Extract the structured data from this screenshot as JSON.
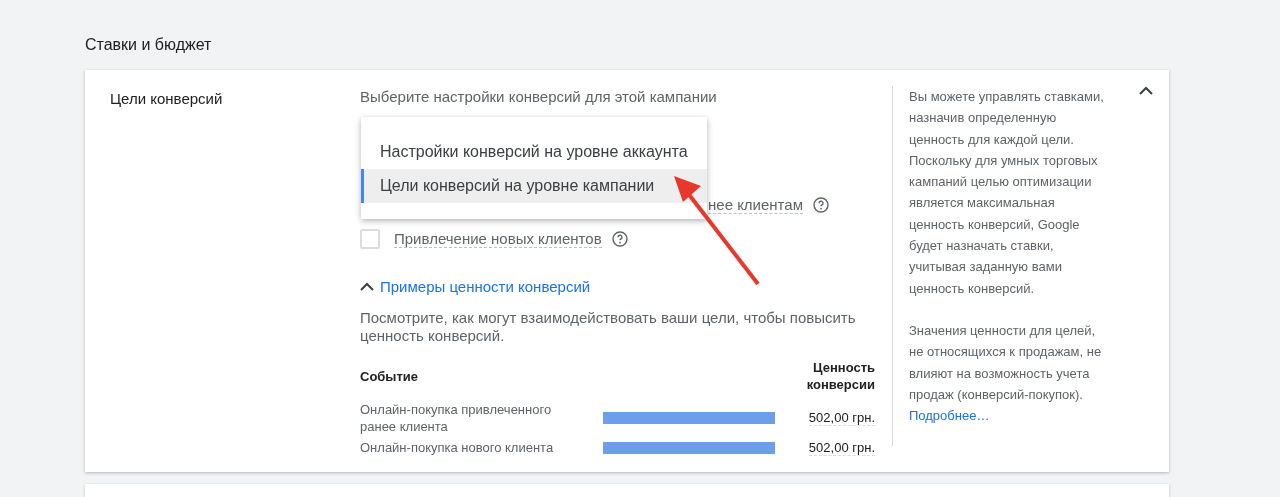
{
  "section_title": "Ставки и бюджет",
  "card": {
    "label": "Цели конверсий",
    "expanded": true,
    "subtitle": "Выберите настройки конверсий для этой кампании",
    "menu": [
      {
        "label": "Настройки конверсий на уровне аккаунта",
        "selected": false
      },
      {
        "label": "Цели конверсий на уровне кампании",
        "selected": true
      }
    ],
    "goals": [
      {
        "label": "нее клиентам",
        "kind": "partial"
      },
      {
        "label": "Привлечение новых клиентов",
        "kind": "checkbox",
        "checked": false
      }
    ],
    "examples_link": "Примеры ценности конверсий",
    "examples_expanded": true,
    "description": "Посмотрите, как могут взаимодействовать ваши цели, чтобы повысить ценность конверсий.",
    "table": {
      "columns": [
        "Событие",
        "Ценность конверсии"
      ],
      "rows": [
        {
          "event": "Онлайн-покупка привлеченного ранее клиента",
          "level": 1,
          "value": "502,00 грн."
        },
        {
          "event": "Онлайн-покупка нового клиента",
          "level": 1,
          "value": "502,00 грн."
        }
      ]
    },
    "help": {
      "paragraphs": [
        "Вы можете управлять ставками, назначив определенную ценность для каждой цели. Поскольку для умных торговых кампаний целью оптимизации является максимальная ценность конверсий, Google будет назначать ставки, учитывая заданную вами ценность конверсий.",
        "Значения ценности для целей, не относящихся к продажам, не влияют на возможность учета продаж (конверсий-покупок)."
      ],
      "link": "Подробнее…"
    }
  }
}
